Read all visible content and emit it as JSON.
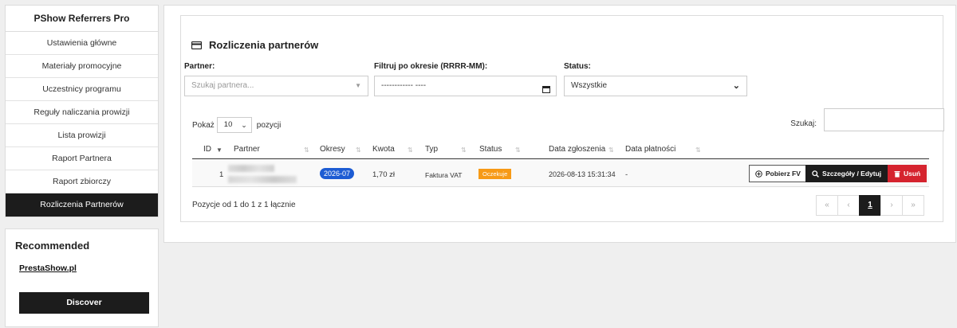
{
  "sidebar": {
    "title": "PShow Referrers Pro",
    "items": [
      {
        "label": "Ustawienia główne"
      },
      {
        "label": "Materiały promocyjne"
      },
      {
        "label": "Uczestnicy programu"
      },
      {
        "label": "Reguły naliczania prowizji"
      },
      {
        "label": "Lista prowizji"
      },
      {
        "label": "Raport Partnera"
      },
      {
        "label": "Raport zbiorczy"
      },
      {
        "label": "Rozliczenia Partnerów"
      }
    ],
    "recommended": {
      "title": "Recommended",
      "link": "PrestaShow.pl",
      "button": "Discover"
    }
  },
  "panel": {
    "title": "Rozliczenia partnerów",
    "filters": {
      "partner_label": "Partner:",
      "partner_placeholder": "Szukaj partnera...",
      "period_label": "Filtruj po okresie (RRRR-MM):",
      "period_value": "------------ ----",
      "status_label": "Status:",
      "status_value": "Wszystkie"
    },
    "length": {
      "prefix": "Pokaż",
      "value": "10",
      "suffix": "pozycji"
    },
    "search_label": "Szukaj:",
    "table": {
      "headers": [
        "ID",
        "Partner",
        "Okresy",
        "Kwota",
        "Typ",
        "Status",
        "Data zgłoszenia",
        "Data płatności"
      ],
      "rows": [
        {
          "id": "1",
          "period": "2026-07",
          "amount": "1,70 zł",
          "type": "Faktura VAT",
          "status": "Oczekuje",
          "submitted": "2026-08-13 15:31:34",
          "paid": "-"
        }
      ],
      "actions": {
        "download": "Pobierz FV",
        "edit": "Szczegóły / Edytuj",
        "delete": "Usuń"
      }
    },
    "info": "Pozycje od 1 do 1 z 1 łącznie",
    "pager": [
      "«",
      "‹",
      "1",
      "›",
      "»"
    ]
  },
  "colors": {
    "accent": "#1c1c1c",
    "period_badge": "#1d5cd3",
    "status_badge": "#f79a16",
    "danger": "#d5232e"
  }
}
